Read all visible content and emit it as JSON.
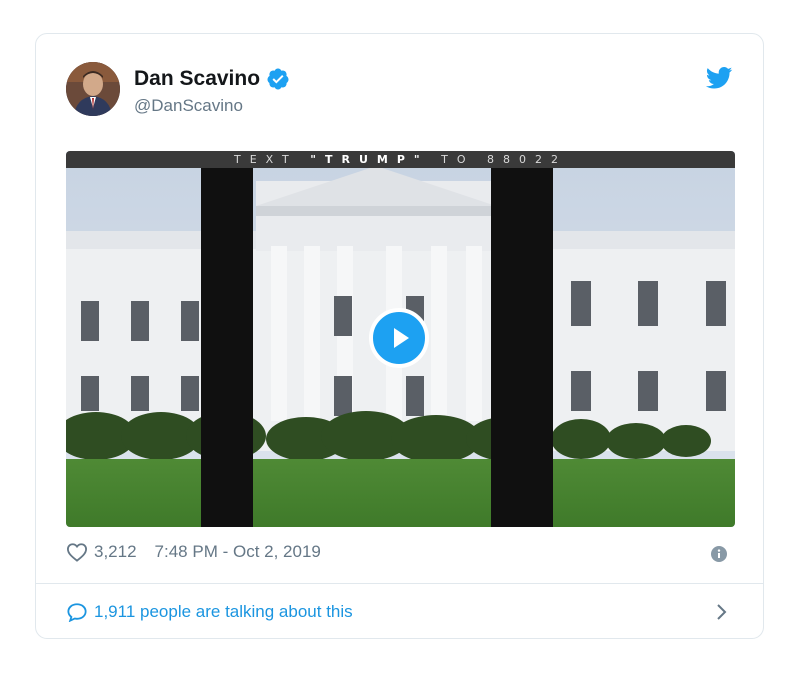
{
  "author": {
    "name": "Dan Scavino",
    "handle": "@DanScavino"
  },
  "media": {
    "caption_parts": [
      "TEXT ",
      "\"TRUMP\"",
      " TO 88022"
    ]
  },
  "meta": {
    "likes": "3,212",
    "timestamp": "7:48 PM - Oct 2, 2019"
  },
  "footer": {
    "talking": "1,911 people are talking about this"
  },
  "colors": {
    "accent": "#1da1f2",
    "link": "#1b95e0",
    "muted": "#657786"
  },
  "icons": [
    "verified-icon",
    "twitter-bird-icon",
    "play-icon",
    "heart-icon",
    "info-icon",
    "comment-bubble-icon",
    "chevron-right-icon"
  ]
}
